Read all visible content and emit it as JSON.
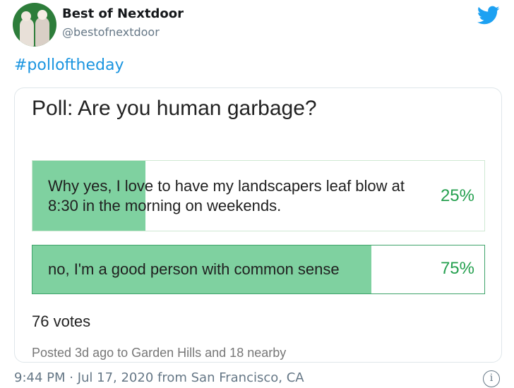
{
  "tweet": {
    "author": {
      "display_name": "Best of Nextdoor",
      "handle": "@bestofnextdoor"
    },
    "text": "#polloftheday",
    "timestamp": "9:44 PM · Jul 17, 2020 from San Francisco, CA",
    "icons": {
      "brand": "twitter-bird-icon",
      "info": "info-icon"
    }
  },
  "poll": {
    "title": "Poll: Are you human garbage?",
    "options": [
      {
        "label": "Why yes, I love to have my landscapers leaf blow at 8:30 in the morning on weekends.",
        "percent_label": "25%",
        "fill_fraction": 0.25
      },
      {
        "label": "no, I'm a good person with common sense",
        "percent_label": "75%",
        "fill_fraction": 0.75
      }
    ],
    "votes": "76 votes",
    "posted": "Posted 3d ago to Garden Hills and 18 nearby"
  },
  "colors": {
    "brand_blue": "#1da1f2",
    "hashtag_blue": "#1b95e0",
    "poll_fill_green": "#7fd1a0",
    "poll_percent_green": "#25a04f"
  }
}
